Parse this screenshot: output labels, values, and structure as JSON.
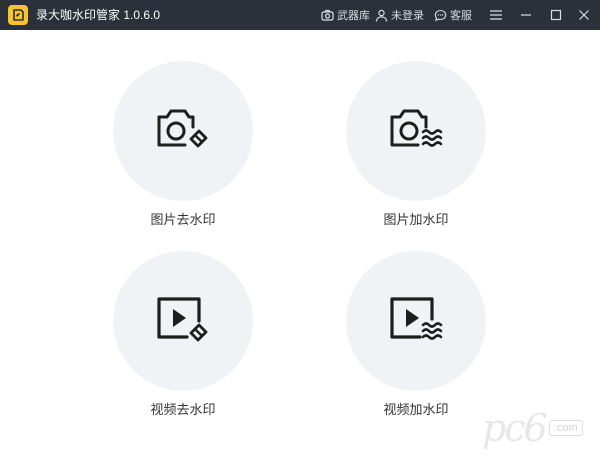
{
  "app": {
    "title": "录大咖水印管家  1.0.6.0"
  },
  "titlebar": {
    "arsenal_label": "武器库",
    "login_label": "未登录",
    "service_label": "客服"
  },
  "features": [
    {
      "label": "图片去水印"
    },
    {
      "label": "图片加水印"
    },
    {
      "label": "视频去水印"
    },
    {
      "label": "视频加水印"
    }
  ],
  "watermark": {
    "text": "pc6",
    "sub": ".com"
  },
  "colors": {
    "titlebar_bg": "#2b303b",
    "logo_accent": "#f7c32e",
    "tile_bg": "#f0f2f6",
    "icon_stroke": "#1e1e1e",
    "label_text": "#333333"
  }
}
